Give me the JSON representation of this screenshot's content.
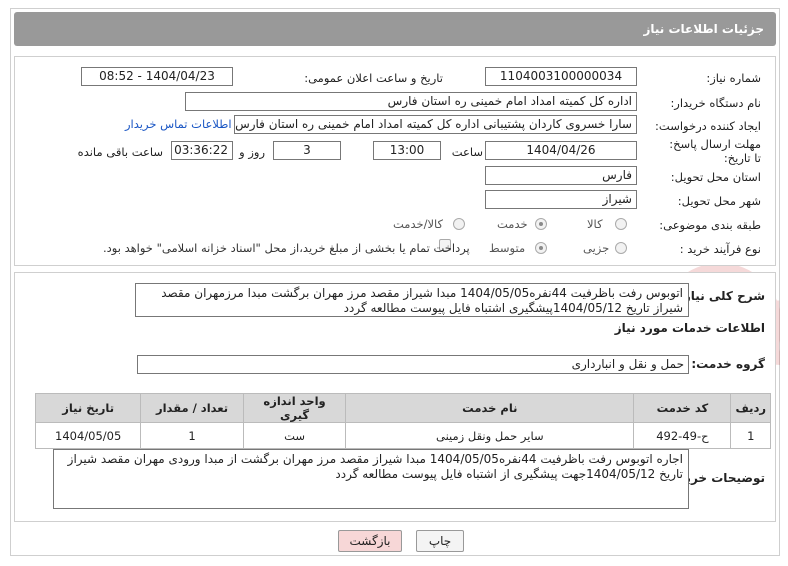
{
  "header": {
    "title": "جزئیات اطلاعات نیاز"
  },
  "fields": {
    "need_number_label": "شماره نیاز:",
    "need_number": "1104003100000034",
    "announce_label": "تاریخ و ساعت اعلان عمومی:",
    "announce_value": "1404/04/23 - 08:52",
    "buyer_org_label": "نام دستگاه خریدار:",
    "buyer_org": "اداره کل کمیته امداد امام خمینی  ره  استان فارس",
    "creator_label": "ایجاد کننده درخواست:",
    "creator": "سارا خسروی کاردان پشتیبانی  اداره کل کمیته امداد امام خمینی  ره  استان فارس",
    "contact_link": "اطلاعات تماس خریدار",
    "deadline_label": "مهلت ارسال پاسخ: تا تاریخ:",
    "deadline_date": "1404/04/26",
    "time_label": "ساعت",
    "deadline_time": "13:00",
    "days_value": "3",
    "days_label": "روز و",
    "remaining_time": "03:36:22",
    "remaining_label": "ساعت باقی مانده",
    "province_label": "استان محل تحویل:",
    "province": "فارس",
    "city_label": "شهر محل تحویل:",
    "city": "شیراز",
    "category_label": "طبقه بندی موضوعی:",
    "category_options": [
      "کالا",
      "خدمت",
      "کالا/خدمت"
    ],
    "process_label": "نوع فرآیند خرید :",
    "process_options": [
      "جزیی",
      "متوسط"
    ],
    "payment_note": "پرداخت تمام یا بخشی از مبلغ خرید،از محل \"اسناد خزانه اسلامی\" خواهد بود."
  },
  "details": {
    "summary_label": "شرح کلی نیاز:",
    "summary": "اتوبوس رفت  باظرفیت 44نفره1404/05/05 مبدا شیراز مقصد مرز مهران برگشت مبدا مرزمهران مقصد شیراز تاریخ 1404/05/12پیشگیری  اشتباه فایل پیوست مطالعه گردد",
    "services_title": "اطلاعات خدمات مورد نیاز",
    "service_group_label": "گروه خدمت:",
    "service_group": "حمل و نقل و انبارداری",
    "buyer_notes_label": "توضیحات خریدار:",
    "buyer_notes": "اجاره اتوبوس رفت  باظرفیت 44نفره1404/05/05 مبدا شیراز مقصد مرز مهران برگشت از مبدا ورودی مهران مقصد شیراز تاریخ 1404/05/12جهت پیشگیری از اشتباه فایل پیوست مطالعه گردد"
  },
  "table": {
    "headers": [
      "ردیف",
      "کد خدمت",
      "نام خدمت",
      "واحد اندازه گیری",
      "تعداد / مقدار",
      "تاریخ نیاز"
    ],
    "rows": [
      [
        "1",
        "ح-49-492",
        "سایر حمل ونقل زمینی",
        "ست",
        "1",
        "1404/05/05"
      ]
    ]
  },
  "buttons": {
    "print": "چاپ",
    "back": "بازگشت"
  }
}
